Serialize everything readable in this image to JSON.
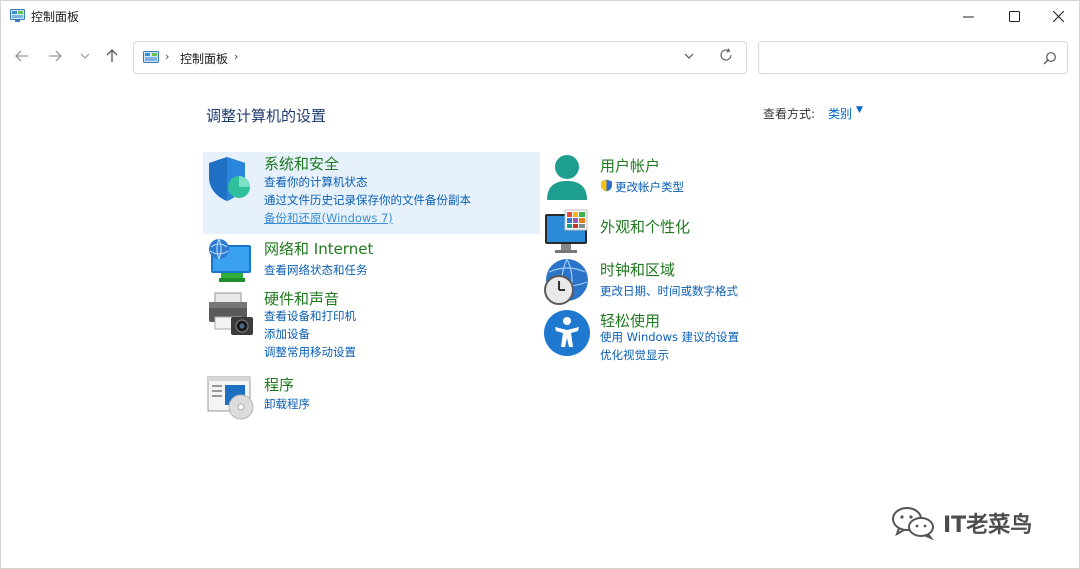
{
  "window": {
    "title": "控制面板"
  },
  "address": {
    "crumb": "控制面板"
  },
  "search": {
    "placeholder": ""
  },
  "header": {
    "page_title": "调整计算机的设置",
    "view_by_label": "查看方式:",
    "view_by_value": "类别"
  },
  "left_categories": [
    {
      "title": "系统和安全",
      "links": [
        "查看你的计算机状态",
        "通过文件历史记录保存你的文件备份副本",
        "备份和还原(Windows 7)"
      ]
    },
    {
      "title": "网络和 Internet",
      "links": [
        "查看网络状态和任务"
      ]
    },
    {
      "title": "硬件和声音",
      "links": [
        "查看设备和打印机",
        "添加设备",
        "调整常用移动设置"
      ]
    },
    {
      "title": "程序",
      "links": [
        "卸载程序"
      ]
    }
  ],
  "right_categories": [
    {
      "title": "用户帐户",
      "links": [
        "更改帐户类型"
      ]
    },
    {
      "title": "外观和个性化",
      "links": []
    },
    {
      "title": "时钟和区域",
      "links": [
        "更改日期、时间或数字格式"
      ]
    },
    {
      "title": "轻松使用",
      "links": [
        "使用 Windows 建议的设置",
        "优化视觉显示"
      ]
    }
  ],
  "watermark": {
    "text": "IT老菜鸟"
  }
}
